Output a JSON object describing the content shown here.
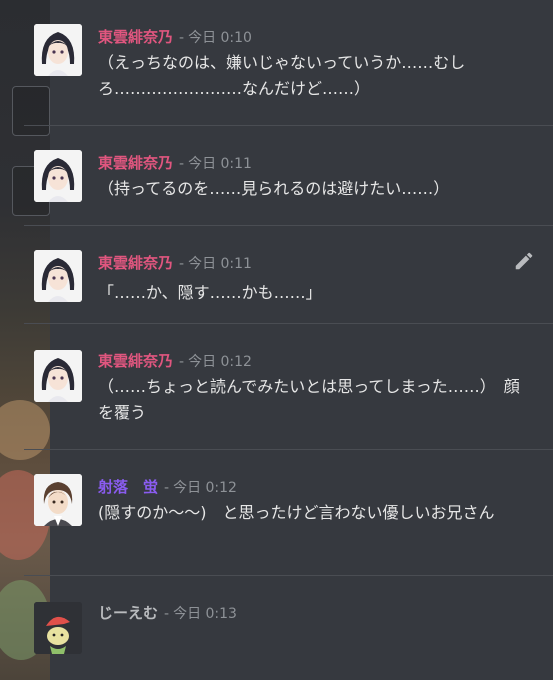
{
  "messages": [
    {
      "author": "東雲緋奈乃",
      "sep": "-",
      "time": "今日 0:10",
      "text": "（えっちなのは、嫌いじゃないっていうか……むしろ……………………なんだけど……）"
    },
    {
      "author": "東雲緋奈乃",
      "sep": "-",
      "time": "今日 0:11",
      "text": "（持ってるのを……見られるのは避けたい……）"
    },
    {
      "author": "東雲緋奈乃",
      "sep": "-",
      "time": "今日 0:11",
      "text": "「……か、隠す……かも……」"
    },
    {
      "author": "東雲緋奈乃",
      "sep": "-",
      "time": "今日 0:12",
      "text": "（……ちょっと読んでみたいとは思ってしまった……）　顔を覆う"
    },
    {
      "author": "射落　蛍",
      "sep": "-",
      "time": "今日 0:12",
      "text": "(隠すのか〜〜)　と思ったけど言わない優しいお兄さん"
    },
    {
      "author": "じーえむ",
      "sep": "-",
      "time": "今日 0:13",
      "text": ""
    }
  ],
  "icons": {
    "edit": "pencil-icon"
  },
  "colors": {
    "background": "#36393f",
    "pink_author": "#e0567f",
    "purple_author": "#8a5cf0",
    "gray_author": "#b9bbbe",
    "timestamp": "#8e9297"
  }
}
